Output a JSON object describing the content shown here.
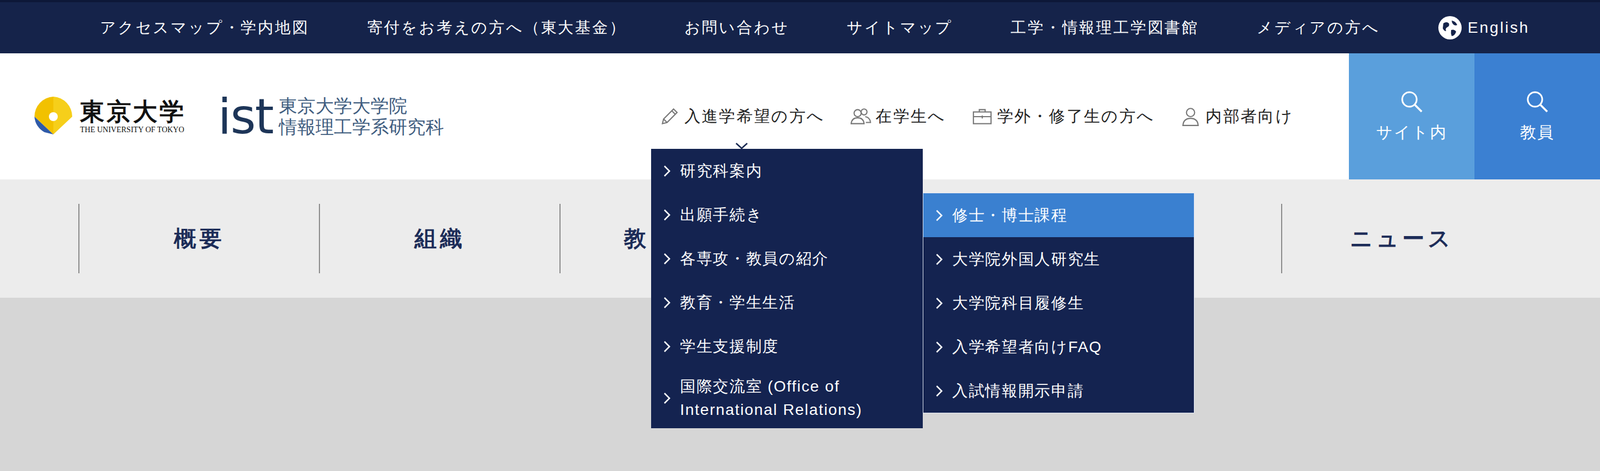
{
  "top_links": [
    {
      "label": "アクセスマップ・学内地図"
    },
    {
      "label": "寄付をお考えの方へ（東大基金）"
    },
    {
      "label": "お問い合わせ"
    },
    {
      "label": "サイトマップ"
    },
    {
      "label": "工学・情報理工学図書館"
    },
    {
      "label": "メディアの方へ"
    }
  ],
  "language": {
    "label": "English"
  },
  "logos": {
    "university": {
      "name": "東京大学",
      "sub": "THE UNIVERSITY OF TOKYO"
    },
    "school": {
      "mark": "ist",
      "line1": "東京大学大学院",
      "line2": "情報理工学系研究科"
    }
  },
  "main_nav": [
    {
      "label": "入進学希望の方へ",
      "kind": "pencil",
      "expanded": true
    },
    {
      "label": "在学生へ",
      "kind": "people",
      "expanded": false
    },
    {
      "label": "学外・修了生の方へ",
      "kind": "briefcase",
      "expanded": false
    },
    {
      "label": "内部者向け",
      "kind": "person",
      "expanded": false
    }
  ],
  "search_buttons": [
    {
      "label": "サイト内",
      "color": "#5a9fdc"
    },
    {
      "label": "教員",
      "color": "#3b80d2"
    }
  ],
  "section_tabs": [
    {
      "label": "概要",
      "cut": false
    },
    {
      "label": "組織",
      "cut": false
    },
    {
      "label": "教",
      "cut": true
    },
    {
      "label": "",
      "cut": true
    },
    {
      "label": "",
      "cut": true
    },
    {
      "label": "ニュース",
      "cut": false
    }
  ],
  "dropdown": {
    "items": [
      {
        "label": "研究科案内",
        "expanded": false,
        "submenu": []
      },
      {
        "label": "出願手続き",
        "expanded": true,
        "submenu": [
          {
            "label": "修士・博士課程",
            "selected": true
          },
          {
            "label": "大学院外国人研究生",
            "selected": false
          },
          {
            "label": "大学院科目履修生",
            "selected": false
          },
          {
            "label": "入学希望者向けFAQ",
            "selected": false
          },
          {
            "label": "入試情報開示申請",
            "selected": false
          }
        ]
      },
      {
        "label": "各専攻・教員の紹介",
        "expanded": false,
        "submenu": []
      },
      {
        "label": "教育・学生生活",
        "expanded": false,
        "submenu": []
      },
      {
        "label": "学生支援制度",
        "expanded": false,
        "submenu": []
      },
      {
        "label": "国際交流室 (Office of International Relations)",
        "expanded": false,
        "submenu": []
      }
    ]
  }
}
